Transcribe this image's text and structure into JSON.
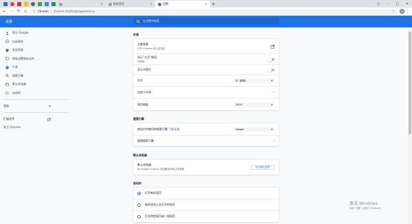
{
  "browser": {
    "pinned_tabs": [
      {
        "icon": "docs-blue-icon",
        "color": "#1a73e8"
      },
      {
        "icon": "red-app-icon",
        "color": "#ea4335"
      },
      {
        "icon": "music-icon",
        "color": "#d93025"
      },
      {
        "icon": "mail-icon",
        "color": "#fbbc04"
      },
      {
        "icon": "globe-icon",
        "color": "#5f6368"
      },
      {
        "icon": "shield-app-icon",
        "color": "#34a853"
      },
      {
        "icon": "translate-icon",
        "color": "#4285f4"
      },
      {
        "icon": "green-app-icon",
        "color": "#0f9d58"
      }
    ],
    "tabs": [
      {
        "title": "",
        "fav_color": "#9aa0a6",
        "active": false
      },
      {
        "title": "新标签页",
        "fav_color": "#9aa0a6",
        "active": false
      },
      {
        "title": "设置",
        "fav_color": "#5f6368",
        "active": true
      }
    ],
    "url_host": "Chrome",
    "url_sep": "|",
    "url_path": "chrome://settings/appearance",
    "close_glyph": "×",
    "newtab_glyph": "+",
    "accent_color": "#1a73e8"
  },
  "header": {
    "title": "设置",
    "search_placeholder": "在设置中搜索"
  },
  "sidebar": {
    "items": [
      {
        "label": "您与 Google",
        "icon": "person-icon",
        "active": false
      },
      {
        "label": "自动填充",
        "icon": "clipboard-icon",
        "active": false
      },
      {
        "label": "安全检查",
        "icon": "shield-icon",
        "active": false
      },
      {
        "label": "隐私设置和安全性",
        "icon": "shield-lock-icon",
        "active": false
      },
      {
        "label": "外观",
        "icon": "palette-icon",
        "active": true
      },
      {
        "label": "搜索引擎",
        "icon": "search-icon",
        "active": false
      },
      {
        "label": "默认浏览器",
        "icon": "browser-icon",
        "active": false
      },
      {
        "label": "启动时",
        "icon": "power-icon",
        "active": false
      }
    ],
    "advanced_label": "高级",
    "extensions_label": "扩展程序",
    "about_label": "关于 Chrome"
  },
  "appearance": {
    "section_title": "外观",
    "theme_label": "主题背景",
    "theme_sub": "打开 Chrome 网上应用店",
    "home_button_label": "显示“主页”按钮",
    "home_button_sub": "已停用",
    "bookmarks_bar_label": "显示书签栏",
    "font_size_label": "字号",
    "font_size_value": "中（推荐）",
    "custom_fonts_label": "自定义字体",
    "zoom_label": "网页缩放",
    "zoom_value": "100%"
  },
  "search_engine": {
    "section_title": "搜索引擎",
    "address_bar_label": "地址栏中使用的搜索引擎",
    "learn_more": "了解详情",
    "engine_value": "Google",
    "manage_label": "管理搜索引擎"
  },
  "default_browser": {
    "section_title": "默认浏览器",
    "label": "默认浏览器",
    "sub": "将 Google Chrome 浏览器设为默认浏览器",
    "button": "设为默认选项"
  },
  "startup": {
    "section_title": "启动时",
    "options": [
      {
        "label": "打开新标签页",
        "selected": true
      },
      {
        "label": "继续浏览上次打开的网页",
        "selected": false
      },
      {
        "label": "打开特定网页或一组网页",
        "selected": false
      }
    ]
  },
  "watermark": {
    "line1": "激活 Windows",
    "line2": "转到“设置”以激活 Windows。"
  }
}
